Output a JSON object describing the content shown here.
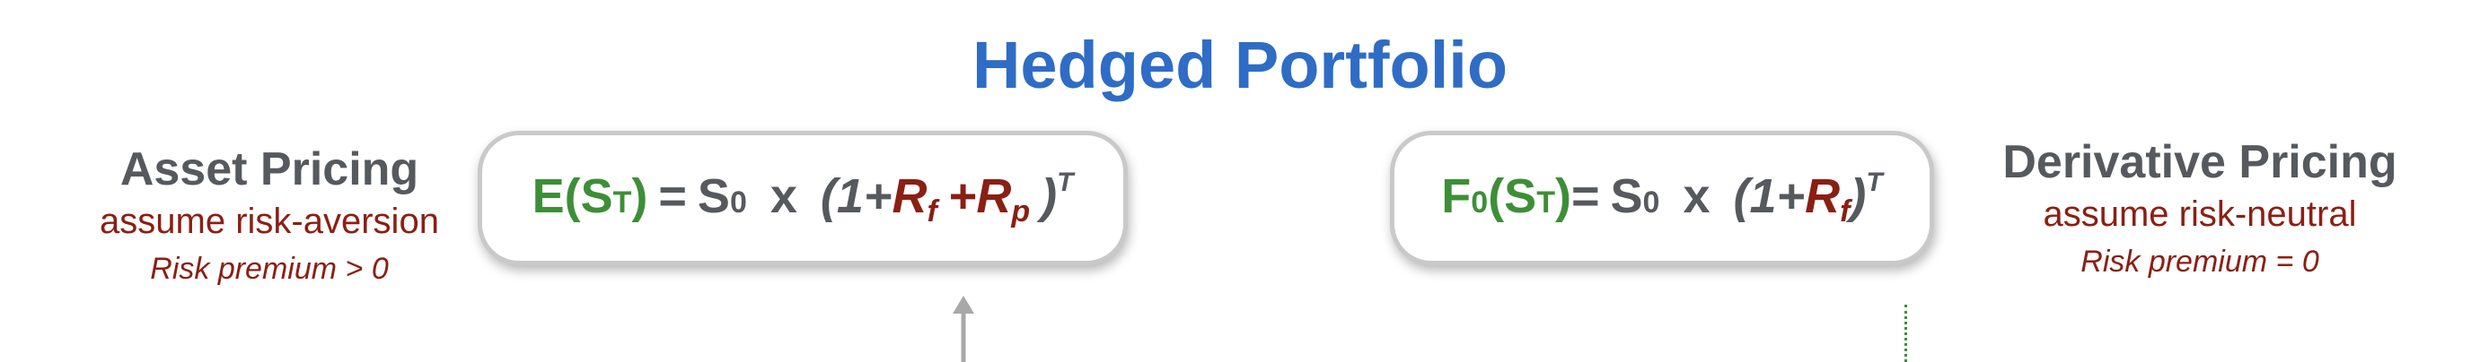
{
  "title": "Hedged Portfolio",
  "left": {
    "heading": "Asset Pricing",
    "subheading": "assume risk-aversion",
    "note": "Risk premium > 0"
  },
  "right": {
    "heading": "Derivative Pricing",
    "subheading": "assume risk-neutral",
    "note": "Risk premium = 0"
  },
  "formula_left": {
    "lhs_prefix": "E(S",
    "lhs_sub": "T",
    "lhs_suffix": ")",
    "equals": "=",
    "base": "S",
    "base_sub": "0",
    "times": "x",
    "open": "(1+",
    "rf": "R",
    "rf_sub": "f",
    "plus": "+",
    "rp": "R",
    "rp_sub": "p",
    "close": ")",
    "exponent": "T"
  },
  "formula_right": {
    "lhs_prefix": "F",
    "lhs_prefix_sub": "0",
    "lhs_mid": "(S",
    "lhs_sub": "T",
    "lhs_suffix": ")",
    "equals": "=",
    "base": "S",
    "base_sub": "0",
    "times": "x",
    "open": "(1+",
    "rf": "R",
    "rf_sub": "f",
    "close": ")",
    "exponent": "T"
  },
  "colors": {
    "title": "#2f6cc5",
    "heading": "#56595e",
    "accent_red": "#8a1f14",
    "accent_green": "#3d8f37",
    "box_border": "#c9c9c9",
    "arrow": "#a8a8a8"
  }
}
